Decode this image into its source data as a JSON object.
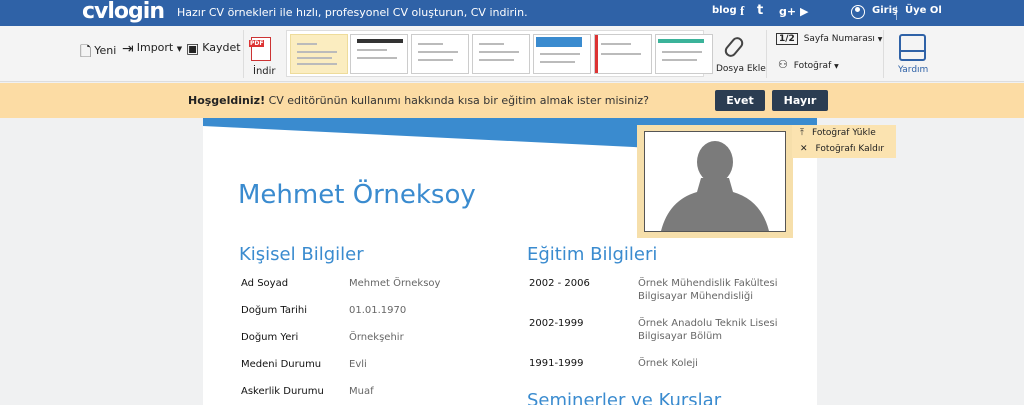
{
  "brand": {
    "logo": "cvlogin",
    "tagline": "Hazır CV örnekleri ile hızlı, profesyonel CV oluşturun, CV indirin."
  },
  "topnav": {
    "blog": "blog",
    "facebook": "f",
    "twitter": "t",
    "gplus": "g+",
    "youtube": "▶",
    "login": "Giriş",
    "signup": "Üye Ol"
  },
  "toolbar": {
    "new": "Yeni",
    "import": "Import",
    "save": "Kaydet",
    "download": "İndir",
    "pdf": "PDF",
    "attach": "Dosya Ekle",
    "page_number": "Sayfa Numarası",
    "photo": "Fotoğraf",
    "help": "Yardım",
    "page_icon": "1/2"
  },
  "welcome": {
    "bold": "Hoşgeldiniz!",
    "text": " CV editörünün kullanımı hakkında kısa bir eğitim almak ister misiniz?",
    "yes": "Evet",
    "no": "Hayır"
  },
  "photo_menu": {
    "upload": "Fotoğraf Yükle",
    "remove": "Fotoğrafı Kaldır"
  },
  "cv": {
    "name": "Mehmet Örneksoy",
    "personal_title": "Kişisel Bilgiler",
    "personal": [
      {
        "label": "Ad Soyad",
        "value": "Mehmet Örneksoy"
      },
      {
        "label": "Doğum Tarihi",
        "value": "01.01.1970"
      },
      {
        "label": "Doğum Yeri",
        "value": "Örnekşehir"
      },
      {
        "label": "Medeni Durumu",
        "value": "Evli"
      },
      {
        "label": "Askerlik Durumu",
        "value": "Muaf"
      }
    ],
    "education_title": "Eğitim Bilgileri",
    "education": [
      {
        "years": "2002 - 2006",
        "line1": "Örnek Mühendislik Fakültesi",
        "line2": "Bilgisayar Mühendisliği"
      },
      {
        "years": "2002-1999",
        "line1": "Örnek Anadolu Teknik Lisesi",
        "line2": "Bilgisayar Bölüm"
      },
      {
        "years": "1991-1999",
        "line1": "Örnek Koleji",
        "line2": ""
      }
    ],
    "seminars_title": "Seminerler ve Kurslar"
  },
  "colors": {
    "topbar": "#2f62a7",
    "accent": "#3a8bcf",
    "welcome_bg": "#fcdca4",
    "button_dark": "#2b3d52"
  }
}
